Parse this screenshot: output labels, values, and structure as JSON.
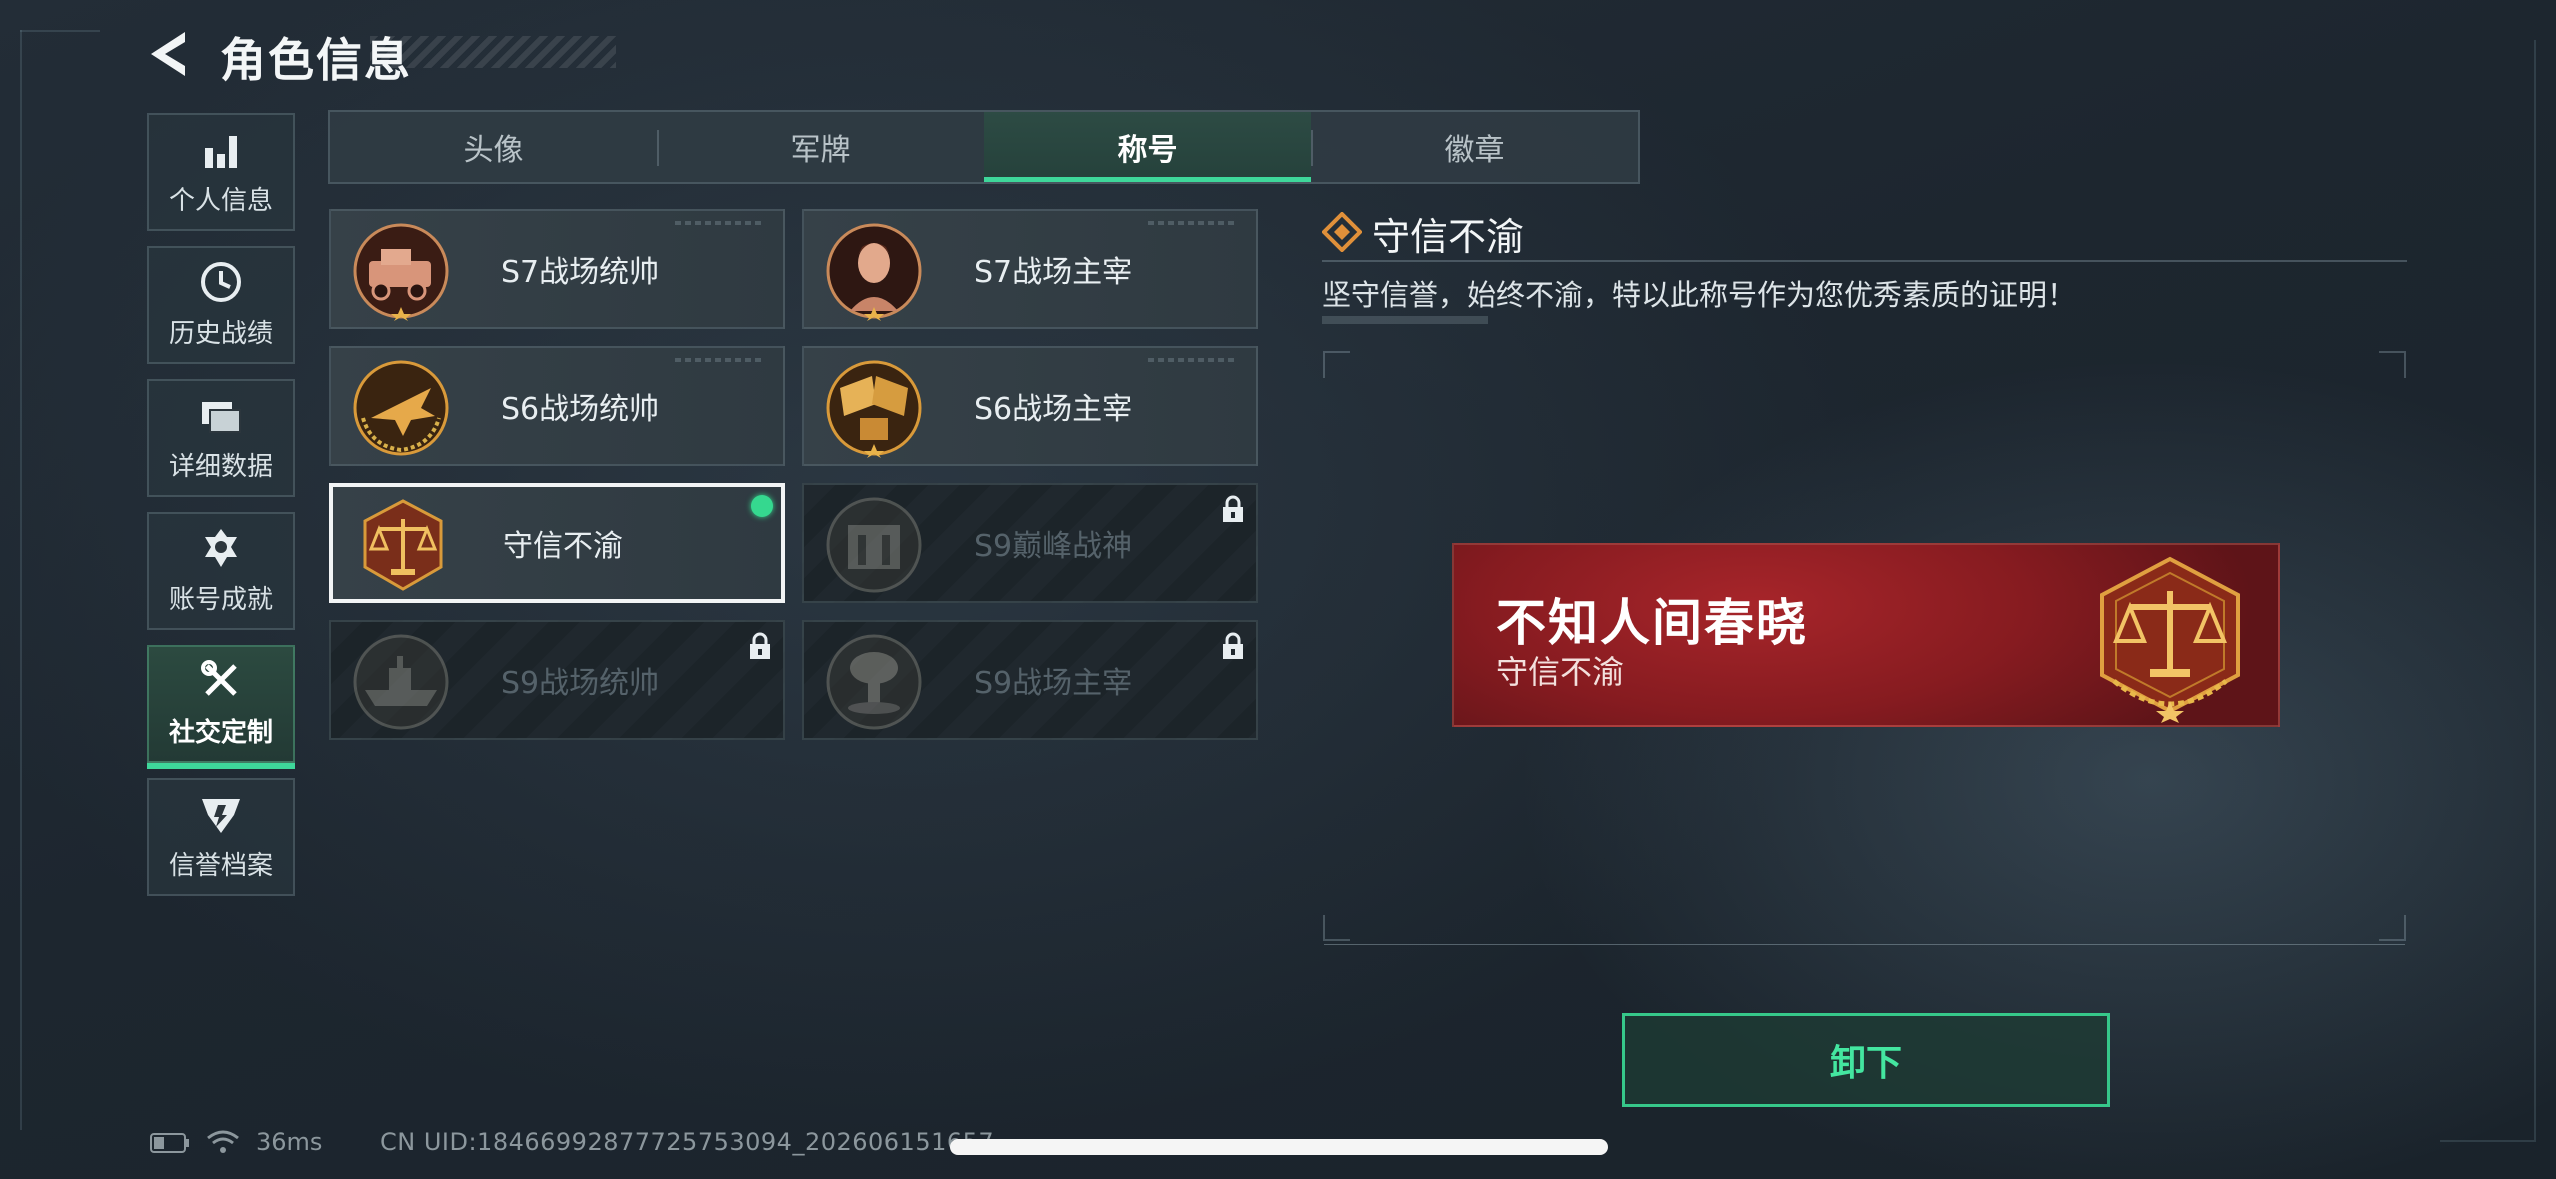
{
  "header": {
    "title": "角色信息"
  },
  "sidebar": {
    "items": [
      {
        "label": "个人信息",
        "icon": "bar-chart-icon",
        "active": false
      },
      {
        "label": "历史战绩",
        "icon": "clock-icon",
        "active": false
      },
      {
        "label": "详细数据",
        "icon": "folders-icon",
        "active": false
      },
      {
        "label": "账号成就",
        "icon": "medal-icon",
        "active": false
      },
      {
        "label": "社交定制",
        "icon": "tools-icon",
        "active": true
      },
      {
        "label": "信誉档案",
        "icon": "shield-icon",
        "active": false
      }
    ]
  },
  "tabs": [
    {
      "label": "头像",
      "active": false
    },
    {
      "label": "军牌",
      "active": false
    },
    {
      "label": "称号",
      "active": true
    },
    {
      "label": "徽章",
      "active": false
    }
  ],
  "titles": [
    {
      "name": "S7战场统帅",
      "locked": false,
      "selected": false,
      "emblem": "armored-car-emblem"
    },
    {
      "name": "S7战场主宰",
      "locked": false,
      "selected": false,
      "emblem": "soldier-portrait-emblem"
    },
    {
      "name": "S6战场统帅",
      "locked": false,
      "selected": false,
      "emblem": "fighter-jet-emblem"
    },
    {
      "name": "S6战场主宰",
      "locked": false,
      "selected": false,
      "emblem": "crossed-flags-emblem"
    },
    {
      "name": "守信不渝",
      "locked": false,
      "selected": true,
      "emblem": "scales-emblem"
    },
    {
      "name": "S9巅峰战神",
      "locked": true,
      "selected": false,
      "emblem": "fortress-emblem"
    },
    {
      "name": "S9战场统帅",
      "locked": true,
      "selected": false,
      "emblem": "warship-emblem"
    },
    {
      "name": "S9战场主宰",
      "locked": true,
      "selected": false,
      "emblem": "explosion-emblem"
    }
  ],
  "detail": {
    "title": "守信不渝",
    "description": "坚守信誉，始终不渝，特以此称号作为您优秀素质的证明！"
  },
  "banner": {
    "player_name": "不知人间春晓",
    "title": "守信不渝"
  },
  "actions": {
    "unequip_label": "卸下"
  },
  "status": {
    "ping": "36ms",
    "uid": "CN UID:1846699287772575309​4_202606151657"
  },
  "colors": {
    "accent": "#3ed79a",
    "banner_red": "#a7252a",
    "emblem_gold": "#d99a3a"
  }
}
